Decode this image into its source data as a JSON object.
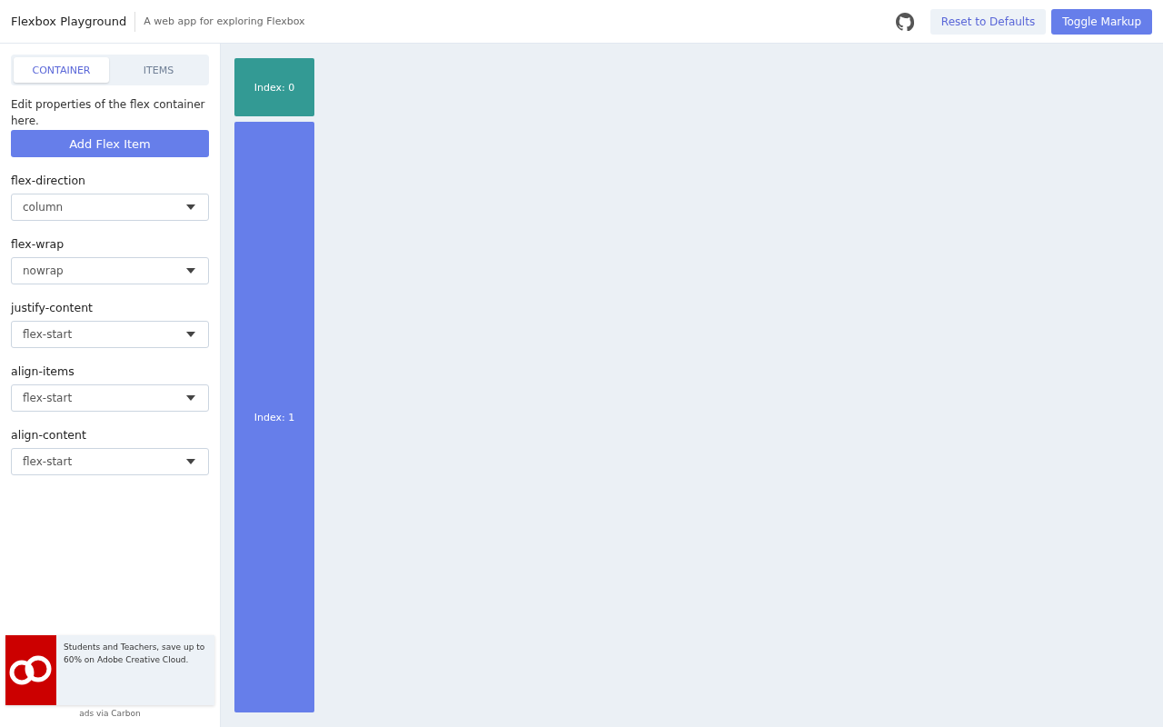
{
  "header": {
    "title": "Flexbox Playground",
    "subtitle": "A web app for exploring Flexbox",
    "buttons": [
      {
        "label": "Reset to Defaults",
        "kind": "secondary"
      },
      {
        "label": "Toggle Markup",
        "kind": "primary"
      }
    ]
  },
  "tabs": [
    {
      "label": "CONTAINER",
      "selected": true
    },
    {
      "label": "ITEMS",
      "selected": false
    }
  ],
  "description": "Edit properties of the flex container here.",
  "add_button": "Add Flex Item",
  "properties": [
    {
      "label": "flex-direction",
      "value": "column"
    },
    {
      "label": "flex-wrap",
      "value": "nowrap"
    },
    {
      "label": "justify-content",
      "value": "flex-start"
    },
    {
      "label": "align-items",
      "value": "flex-start"
    },
    {
      "label": "align-content",
      "value": "flex-start"
    }
  ],
  "ad": {
    "text": "Students and Teachers, save up to 60% on Adobe Creative Cloud.",
    "footer": "ads via Carbon"
  },
  "flex_items": [
    {
      "label": "Index: 0",
      "color": "#339a94"
    },
    {
      "label": "Index: 1",
      "color": "#667eea"
    }
  ]
}
